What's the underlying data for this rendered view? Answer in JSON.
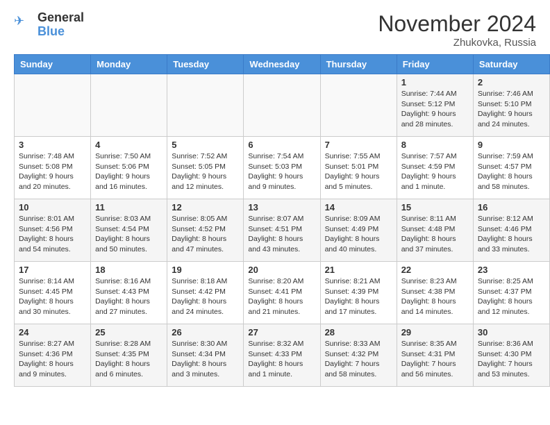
{
  "header": {
    "logo_general": "General",
    "logo_blue": "Blue",
    "month_title": "November 2024",
    "location": "Zhukovka, Russia"
  },
  "calendar": {
    "days_of_week": [
      "Sunday",
      "Monday",
      "Tuesday",
      "Wednesday",
      "Thursday",
      "Friday",
      "Saturday"
    ],
    "weeks": [
      [
        {
          "day": "",
          "info": ""
        },
        {
          "day": "",
          "info": ""
        },
        {
          "day": "",
          "info": ""
        },
        {
          "day": "",
          "info": ""
        },
        {
          "day": "",
          "info": ""
        },
        {
          "day": "1",
          "info": "Sunrise: 7:44 AM\nSunset: 5:12 PM\nDaylight: 9 hours and 28 minutes."
        },
        {
          "day": "2",
          "info": "Sunrise: 7:46 AM\nSunset: 5:10 PM\nDaylight: 9 hours and 24 minutes."
        }
      ],
      [
        {
          "day": "3",
          "info": "Sunrise: 7:48 AM\nSunset: 5:08 PM\nDaylight: 9 hours and 20 minutes."
        },
        {
          "day": "4",
          "info": "Sunrise: 7:50 AM\nSunset: 5:06 PM\nDaylight: 9 hours and 16 minutes."
        },
        {
          "day": "5",
          "info": "Sunrise: 7:52 AM\nSunset: 5:05 PM\nDaylight: 9 hours and 12 minutes."
        },
        {
          "day": "6",
          "info": "Sunrise: 7:54 AM\nSunset: 5:03 PM\nDaylight: 9 hours and 9 minutes."
        },
        {
          "day": "7",
          "info": "Sunrise: 7:55 AM\nSunset: 5:01 PM\nDaylight: 9 hours and 5 minutes."
        },
        {
          "day": "8",
          "info": "Sunrise: 7:57 AM\nSunset: 4:59 PM\nDaylight: 9 hours and 1 minute."
        },
        {
          "day": "9",
          "info": "Sunrise: 7:59 AM\nSunset: 4:57 PM\nDaylight: 8 hours and 58 minutes."
        }
      ],
      [
        {
          "day": "10",
          "info": "Sunrise: 8:01 AM\nSunset: 4:56 PM\nDaylight: 8 hours and 54 minutes."
        },
        {
          "day": "11",
          "info": "Sunrise: 8:03 AM\nSunset: 4:54 PM\nDaylight: 8 hours and 50 minutes."
        },
        {
          "day": "12",
          "info": "Sunrise: 8:05 AM\nSunset: 4:52 PM\nDaylight: 8 hours and 47 minutes."
        },
        {
          "day": "13",
          "info": "Sunrise: 8:07 AM\nSunset: 4:51 PM\nDaylight: 8 hours and 43 minutes."
        },
        {
          "day": "14",
          "info": "Sunrise: 8:09 AM\nSunset: 4:49 PM\nDaylight: 8 hours and 40 minutes."
        },
        {
          "day": "15",
          "info": "Sunrise: 8:11 AM\nSunset: 4:48 PM\nDaylight: 8 hours and 37 minutes."
        },
        {
          "day": "16",
          "info": "Sunrise: 8:12 AM\nSunset: 4:46 PM\nDaylight: 8 hours and 33 minutes."
        }
      ],
      [
        {
          "day": "17",
          "info": "Sunrise: 8:14 AM\nSunset: 4:45 PM\nDaylight: 8 hours and 30 minutes."
        },
        {
          "day": "18",
          "info": "Sunrise: 8:16 AM\nSunset: 4:43 PM\nDaylight: 8 hours and 27 minutes."
        },
        {
          "day": "19",
          "info": "Sunrise: 8:18 AM\nSunset: 4:42 PM\nDaylight: 8 hours and 24 minutes."
        },
        {
          "day": "20",
          "info": "Sunrise: 8:20 AM\nSunset: 4:41 PM\nDaylight: 8 hours and 21 minutes."
        },
        {
          "day": "21",
          "info": "Sunrise: 8:21 AM\nSunset: 4:39 PM\nDaylight: 8 hours and 17 minutes."
        },
        {
          "day": "22",
          "info": "Sunrise: 8:23 AM\nSunset: 4:38 PM\nDaylight: 8 hours and 14 minutes."
        },
        {
          "day": "23",
          "info": "Sunrise: 8:25 AM\nSunset: 4:37 PM\nDaylight: 8 hours and 12 minutes."
        }
      ],
      [
        {
          "day": "24",
          "info": "Sunrise: 8:27 AM\nSunset: 4:36 PM\nDaylight: 8 hours and 9 minutes."
        },
        {
          "day": "25",
          "info": "Sunrise: 8:28 AM\nSunset: 4:35 PM\nDaylight: 8 hours and 6 minutes."
        },
        {
          "day": "26",
          "info": "Sunrise: 8:30 AM\nSunset: 4:34 PM\nDaylight: 8 hours and 3 minutes."
        },
        {
          "day": "27",
          "info": "Sunrise: 8:32 AM\nSunset: 4:33 PM\nDaylight: 8 hours and 1 minute."
        },
        {
          "day": "28",
          "info": "Sunrise: 8:33 AM\nSunset: 4:32 PM\nDaylight: 7 hours and 58 minutes."
        },
        {
          "day": "29",
          "info": "Sunrise: 8:35 AM\nSunset: 4:31 PM\nDaylight: 7 hours and 56 minutes."
        },
        {
          "day": "30",
          "info": "Sunrise: 8:36 AM\nSunset: 4:30 PM\nDaylight: 7 hours and 53 minutes."
        }
      ]
    ]
  }
}
